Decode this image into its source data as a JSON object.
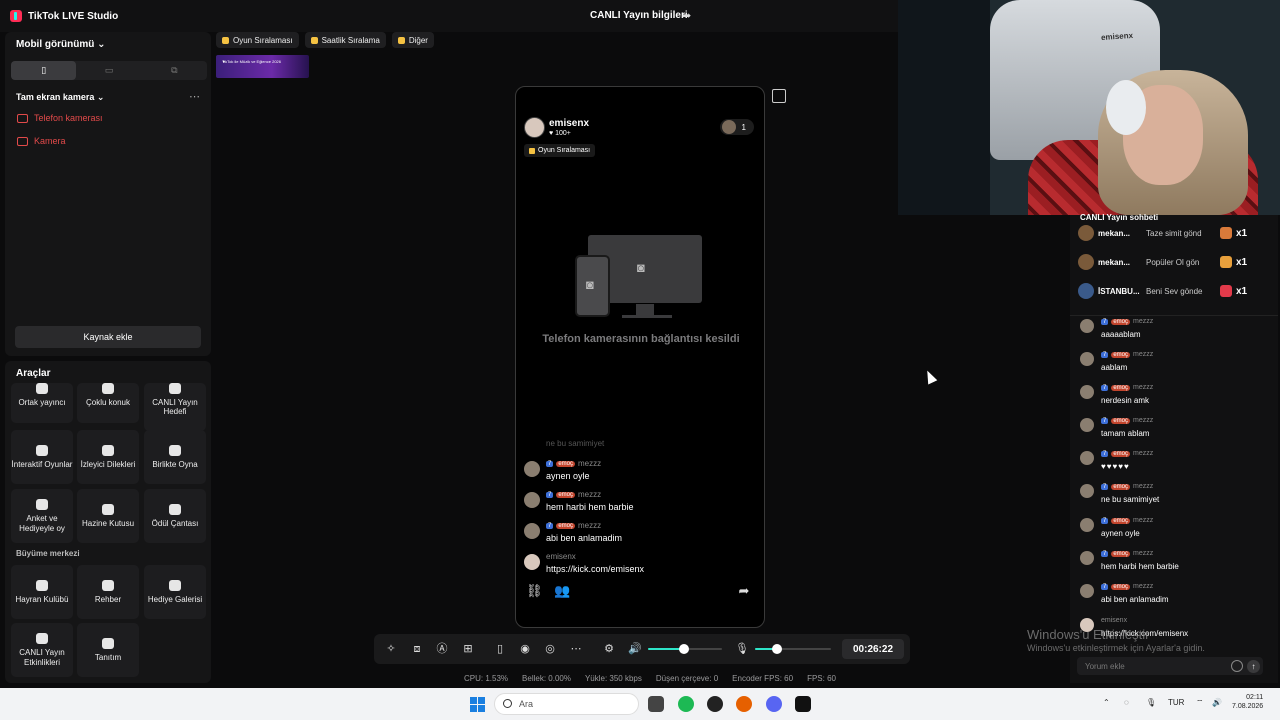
{
  "app": {
    "title": "TikTok LIVE Studio",
    "center_title": "CANLI Yayın bilgileri"
  },
  "left": {
    "mobile_view": "Mobil görünümü",
    "source_group": "Tam ekran kamera",
    "sources": [
      "Telefon kamerası",
      "Kamera"
    ],
    "add_source": "Kaynak ekle"
  },
  "tools": {
    "title": "Araçlar",
    "items": [
      "Ortak yayıncı",
      "Çoklu konuk",
      "CANLI Yayın Hedefi",
      "İnteraktif Oyunlar",
      "İzleyici Dilekleri",
      "Birlikte Oyna",
      "Anket ve Hediyeyle oy",
      "Hazine Kutusu",
      "Ödül Çantası"
    ],
    "growth_title": "Büyüme merkezi",
    "growth_items": [
      "Hayran Kulübü",
      "Rehber",
      "Hediye Galerisi",
      "CANLI Yayın Etkinlikleri",
      "Tanıtım"
    ]
  },
  "tabs": [
    "Oyun Sıralaması",
    "Saatlik Sıralama",
    "Diğer"
  ],
  "banner": {
    "text": "TikTok ile Müzik ve Eğlence 2026"
  },
  "phone": {
    "username": "emisenx",
    "likes": "100+",
    "viewer_count": "1",
    "ranking_chip": "Oyun Sıralaması",
    "disconnected": "Telefon kamerasının bağlantısı kesildi",
    "faded_message": "ne bu samimiyet",
    "messages": [
      {
        "level": "7",
        "badge": "emoç",
        "user": "mezzz",
        "text": "aynen oyle"
      },
      {
        "level": "7",
        "badge": "emoç",
        "user": "mezzz",
        "text": "hem harbi hem barbie"
      },
      {
        "level": "7",
        "badge": "emoç",
        "user": "mezzz",
        "text": "abi ben anlamadim"
      }
    ],
    "host_message": {
      "user": "emisenx",
      "text": "https://kick.com/emisenx"
    }
  },
  "controls": {
    "timer": "00:26:22",
    "mic_level": 0.29,
    "speaker_level": 0.48
  },
  "stats": [
    "CPU: 1.53%",
    "Bellek: 0.00%",
    "Yükle: 350 kbps",
    "Düşen çerçeve: 0",
    "Encoder FPS: 60",
    "FPS: 60"
  ],
  "webcam": {
    "chair_text": "emisenx"
  },
  "chat": {
    "title": "CANLI Yayın sohbeti",
    "gifts": [
      {
        "user": "mekan...",
        "text": "Taze simit gönd",
        "count": "x1"
      },
      {
        "user": "mekan...",
        "text": "Popüler Ol gön",
        "count": "x1"
      },
      {
        "user": "İSTANBU...",
        "text": "Beni Sev gönde",
        "count": "x1"
      }
    ],
    "messages": [
      {
        "level": "7",
        "badge": "emoç",
        "user": "mezzz",
        "text": "aaaaablam"
      },
      {
        "level": "7",
        "badge": "emoç",
        "user": "mezzz",
        "text": "aablam"
      },
      {
        "level": "7",
        "badge": "emoç",
        "user": "mezzz",
        "text": "nerdesin amk"
      },
      {
        "level": "7",
        "badge": "emoç",
        "user": "mezzz",
        "text": "tamam ablam"
      },
      {
        "level": "7",
        "badge": "emoç",
        "user": "mezzz",
        "text": "♥♥♥♥♥"
      },
      {
        "level": "7",
        "badge": "emoç",
        "user": "mezzz",
        "text": "ne bu samimiyet"
      },
      {
        "level": "7",
        "badge": "emoç",
        "user": "mezzz",
        "text": "aynen oyle"
      },
      {
        "level": "7",
        "badge": "emoç",
        "user": "mezzz",
        "text": "hem harbi hem barbie"
      },
      {
        "level": "7",
        "badge": "emoç",
        "user": "mezzz",
        "text": "abi ben anlamadim"
      }
    ],
    "host_message": {
      "user": "emisenx",
      "text": "https://kick.com/emisenx"
    },
    "input_placeholder": "Yorum ekle"
  },
  "watermark": {
    "line1": "Windows'u Etkinleştir",
    "line2": "Windows'u etkinleştirmek için Ayarlar'a gidin."
  },
  "taskbar": {
    "search": "Ara",
    "lang": "TUR",
    "time": "02:11",
    "date": "7.08.2026"
  }
}
